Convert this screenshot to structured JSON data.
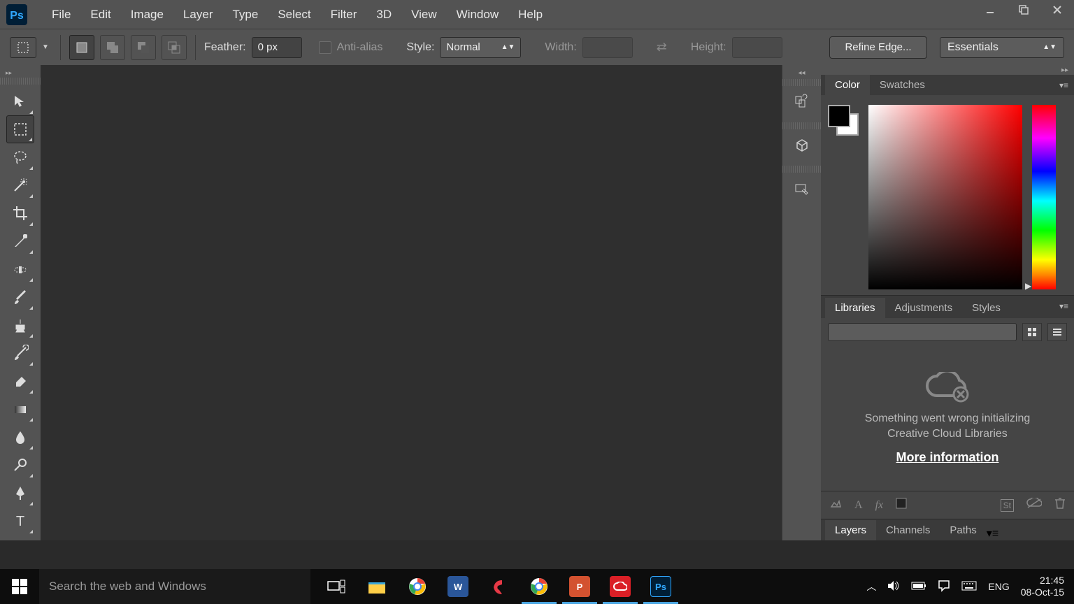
{
  "menu": {
    "items": [
      "File",
      "Edit",
      "Image",
      "Layer",
      "Type",
      "Select",
      "Filter",
      "3D",
      "View",
      "Window",
      "Help"
    ]
  },
  "options": {
    "feather_label": "Feather:",
    "feather_value": "0 px",
    "antialias_label": "Anti-alias",
    "style_label": "Style:",
    "style_value": "Normal",
    "width_label": "Width:",
    "width_value": "",
    "height_label": "Height:",
    "height_value": "",
    "refine_label": "Refine Edge...",
    "workspace_value": "Essentials"
  },
  "panels": {
    "color_tab": "Color",
    "swatches_tab": "Swatches",
    "libraries_tab": "Libraries",
    "adjustments_tab": "Adjustments",
    "styles_tab": "Styles",
    "layers_tab": "Layers",
    "channels_tab": "Channels",
    "paths_tab": "Paths"
  },
  "libraries": {
    "error_line1": "Something went wrong initializing",
    "error_line2": "Creative Cloud Libraries",
    "more_info": "More information"
  },
  "taskbar": {
    "search_placeholder": "Search the web and Windows",
    "lang": "ENG",
    "time": "21:45",
    "date": "08-Oct-15"
  }
}
